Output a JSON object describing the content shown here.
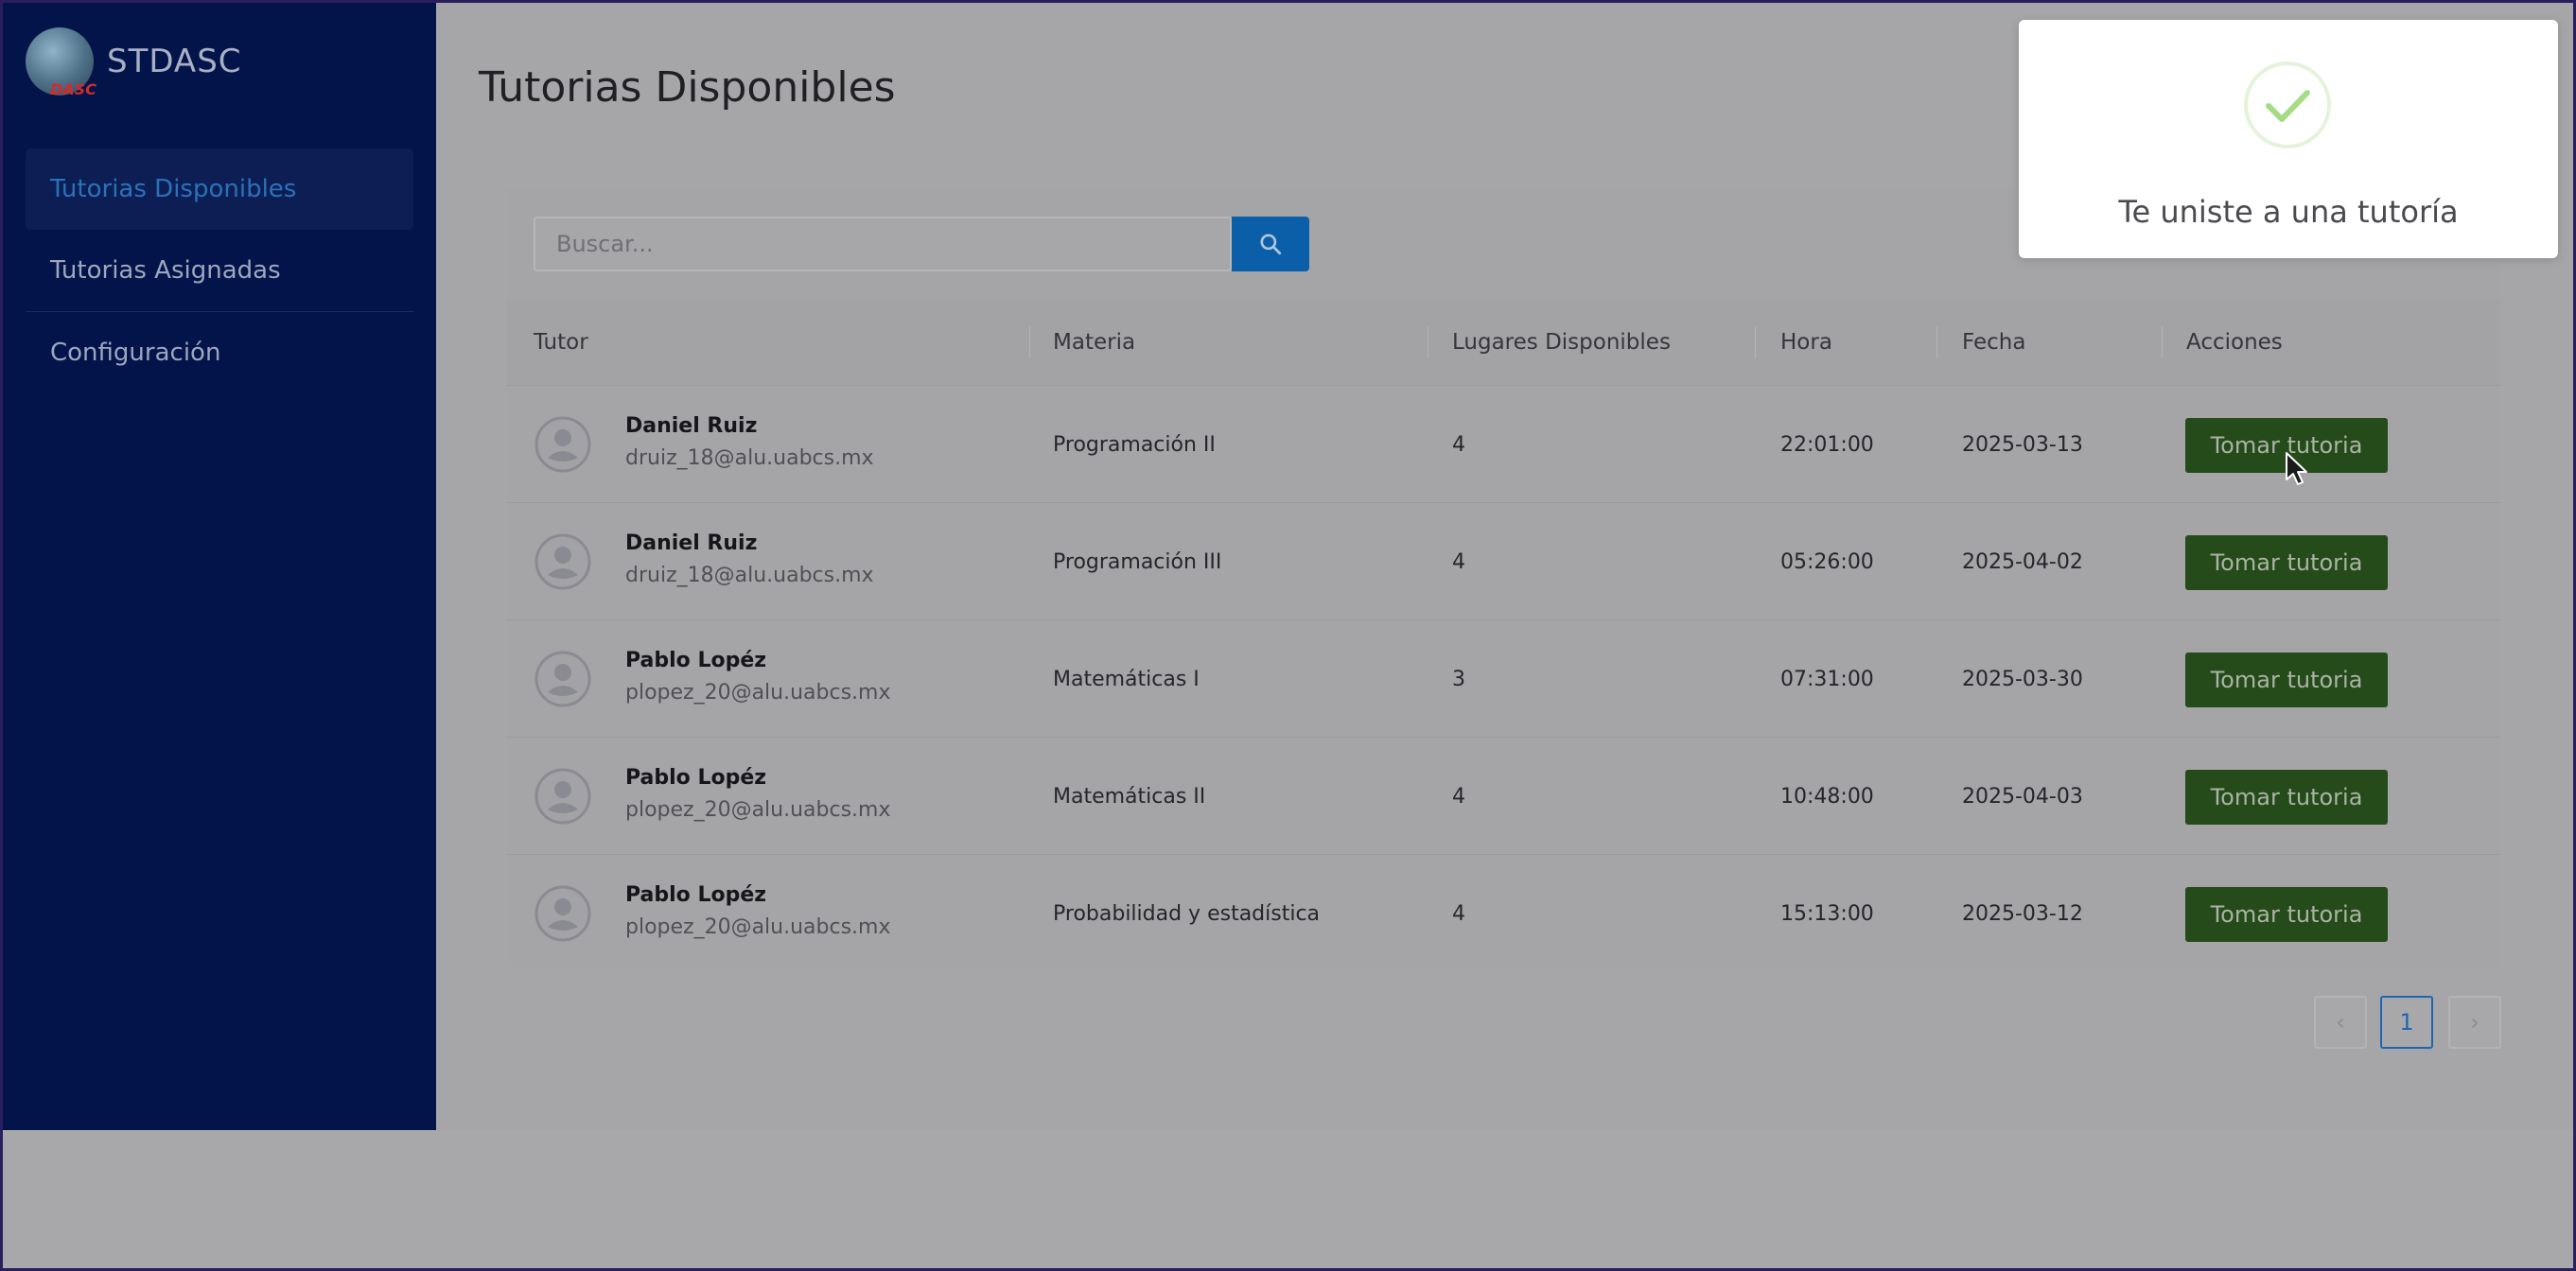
{
  "brand": {
    "name": "STDASC",
    "logo_mark": "DASC"
  },
  "sidebar": {
    "items": [
      {
        "label": "Tutorias Disponibles",
        "active": true
      },
      {
        "label": "Tutorias Asignadas",
        "active": false
      },
      {
        "label": "Configuración",
        "active": false
      }
    ]
  },
  "page": {
    "title": "Tutorias Disponibles"
  },
  "search": {
    "placeholder": "Buscar...",
    "icon": "search-icon"
  },
  "table": {
    "columns": [
      "Tutor",
      "Materia",
      "Lugares Disponibles",
      "Hora",
      "Fecha",
      "Acciones"
    ],
    "rows": [
      {
        "name": "Daniel Ruiz",
        "email": "druiz_18@alu.uabcs.mx",
        "materia": "Programación II",
        "lugares": "4",
        "hora": "22:01:00",
        "fecha": "2025-03-13",
        "action": "Tomar tutoria"
      },
      {
        "name": "Daniel Ruiz",
        "email": "druiz_18@alu.uabcs.mx",
        "materia": "Programación III",
        "lugares": "4",
        "hora": "05:26:00",
        "fecha": "2025-04-02",
        "action": "Tomar tutoria"
      },
      {
        "name": "Pablo Lopéz",
        "email": "plopez_20@alu.uabcs.mx",
        "materia": "Matemáticas I",
        "lugares": "3",
        "hora": "07:31:00",
        "fecha": "2025-03-30",
        "action": "Tomar tutoria"
      },
      {
        "name": "Pablo Lopéz",
        "email": "plopez_20@alu.uabcs.mx",
        "materia": "Matemáticas II",
        "lugares": "4",
        "hora": "10:48:00",
        "fecha": "2025-04-03",
        "action": "Tomar tutoria"
      },
      {
        "name": "Pablo Lopéz",
        "email": "plopez_20@alu.uabcs.mx",
        "materia": "Probabilidad y estadística",
        "lugares": "4",
        "hora": "15:13:00",
        "fecha": "2025-03-12",
        "action": "Tomar tutoria"
      }
    ]
  },
  "pagination": {
    "current": "1",
    "prev": "‹",
    "next": "›"
  },
  "toast": {
    "message": "Te uniste a una tutoría",
    "icon": "check-icon"
  },
  "colors": {
    "sidebar": "#021449",
    "active_nav": "#2a72b8",
    "search_button": "#0b5fa8",
    "action_button": "#254b1a",
    "toast_check": "#a5dc86"
  }
}
